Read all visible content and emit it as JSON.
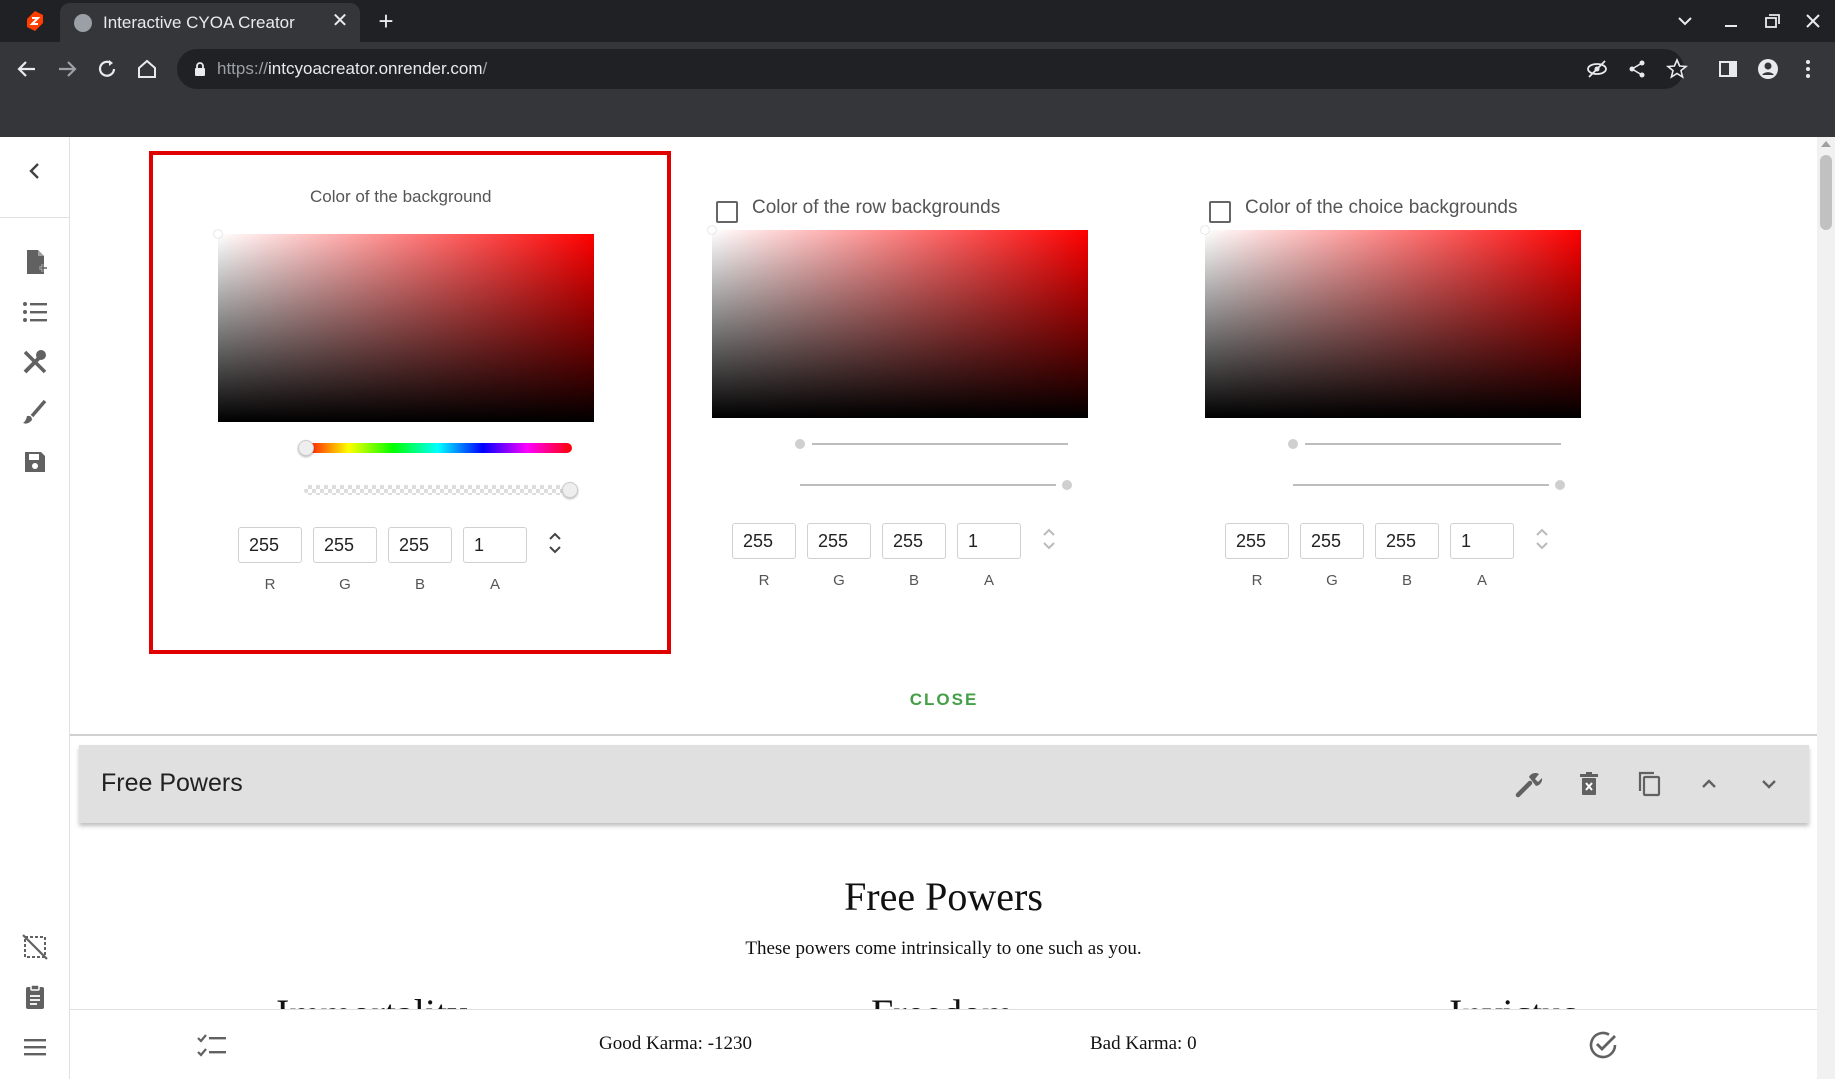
{
  "browser": {
    "tab_title": "Interactive CYOA Creator",
    "url_prefix": "https://",
    "url_host": "intcyoacreator.onrender.com",
    "url_suffix": "/"
  },
  "pickers": [
    {
      "title": "Color of the background",
      "has_checkbox": false,
      "r": "255",
      "g": "255",
      "b": "255",
      "a": "1",
      "labels": {
        "r": "R",
        "g": "G",
        "b": "B",
        "a": "A"
      }
    },
    {
      "title": "Color of the row backgrounds",
      "has_checkbox": true,
      "r": "255",
      "g": "255",
      "b": "255",
      "a": "1",
      "labels": {
        "r": "R",
        "g": "G",
        "b": "B",
        "a": "A"
      }
    },
    {
      "title": "Color of the choice backgrounds",
      "has_checkbox": true,
      "r": "255",
      "g": "255",
      "b": "255",
      "a": "1",
      "labels": {
        "r": "R",
        "g": "G",
        "b": "B",
        "a": "A"
      }
    }
  ],
  "close_label": "CLOSE",
  "row": {
    "header_title": "Free Powers",
    "title": "Free Powers",
    "description": "These powers come intrinsically to one such as you.",
    "choices": [
      "Immortality",
      "Freedom",
      "Invictus"
    ]
  },
  "points": {
    "good_karma": "Good Karma: -1230",
    "bad_karma": "Bad Karma: 0"
  },
  "colors": {
    "accent_green": "#43a047",
    "highlight_red": "#e00000",
    "picker_hue": "#ff0000"
  }
}
